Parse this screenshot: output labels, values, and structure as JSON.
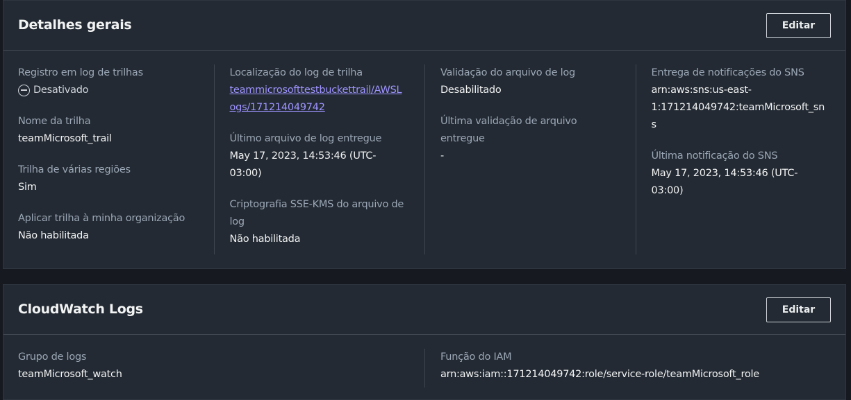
{
  "general": {
    "title": "Detalhes gerais",
    "edit_label": "Editar",
    "col1": {
      "logging_label": "Registro em log de trilhas",
      "logging_value": "Desativado",
      "trail_name_label": "Nome da trilha",
      "trail_name_value": "teamMicrosoft_trail",
      "multi_region_label": "Trilha de várias regiões",
      "multi_region_value": "Sim",
      "org_label": "Aplicar trilha à minha organização",
      "org_value": "Não habilitada"
    },
    "col2": {
      "log_location_label": "Localização do log de trilha",
      "log_location_line1": "teammicrosofttestbuckettrail/AWSL",
      "log_location_line2": "ogs/171214049742",
      "last_log_label": "Último arquivo de log entregue",
      "last_log_line1": "May 17, 2023, 14:53:46 (UTC-",
      "last_log_line2": "03:00)",
      "sse_label_line1": "Criptografia SSE-KMS do arquivo de",
      "sse_label_line2": "log",
      "sse_value": "Não habilitada"
    },
    "col3": {
      "validation_label": "Validação do arquivo de log",
      "validation_value": "Desabilitado",
      "last_validation_label_line1": "Última validação de arquivo",
      "last_validation_label_line2": "entregue",
      "last_validation_value": "-"
    },
    "col4": {
      "sns_label": "Entrega de notificações do SNS",
      "sns_line1": "arn:aws:sns:us-east-",
      "sns_line2": "1:171214049742:teamMicrosoft_sn",
      "sns_line3": "s",
      "last_sns_label": "Última notificação do SNS",
      "last_sns_line1": "May 17, 2023, 14:53:46 (UTC-",
      "last_sns_line2": "03:00)"
    }
  },
  "cloudwatch": {
    "title": "CloudWatch Logs",
    "edit_label": "Editar",
    "log_group_label": "Grupo de logs",
    "log_group_value": "teamMicrosoft_watch",
    "iam_role_label": "Função do IAM",
    "iam_role_value": "arn:aws:iam::171214049742:role/service-role/teamMicrosoft_role"
  },
  "colors": {
    "background": "#16191f",
    "panel": "#232a33",
    "link": "#9f94ff",
    "label": "#9ba7b6",
    "value": "#f2f3f3"
  },
  "icons": {
    "logging_status": "minus-circle-icon"
  }
}
